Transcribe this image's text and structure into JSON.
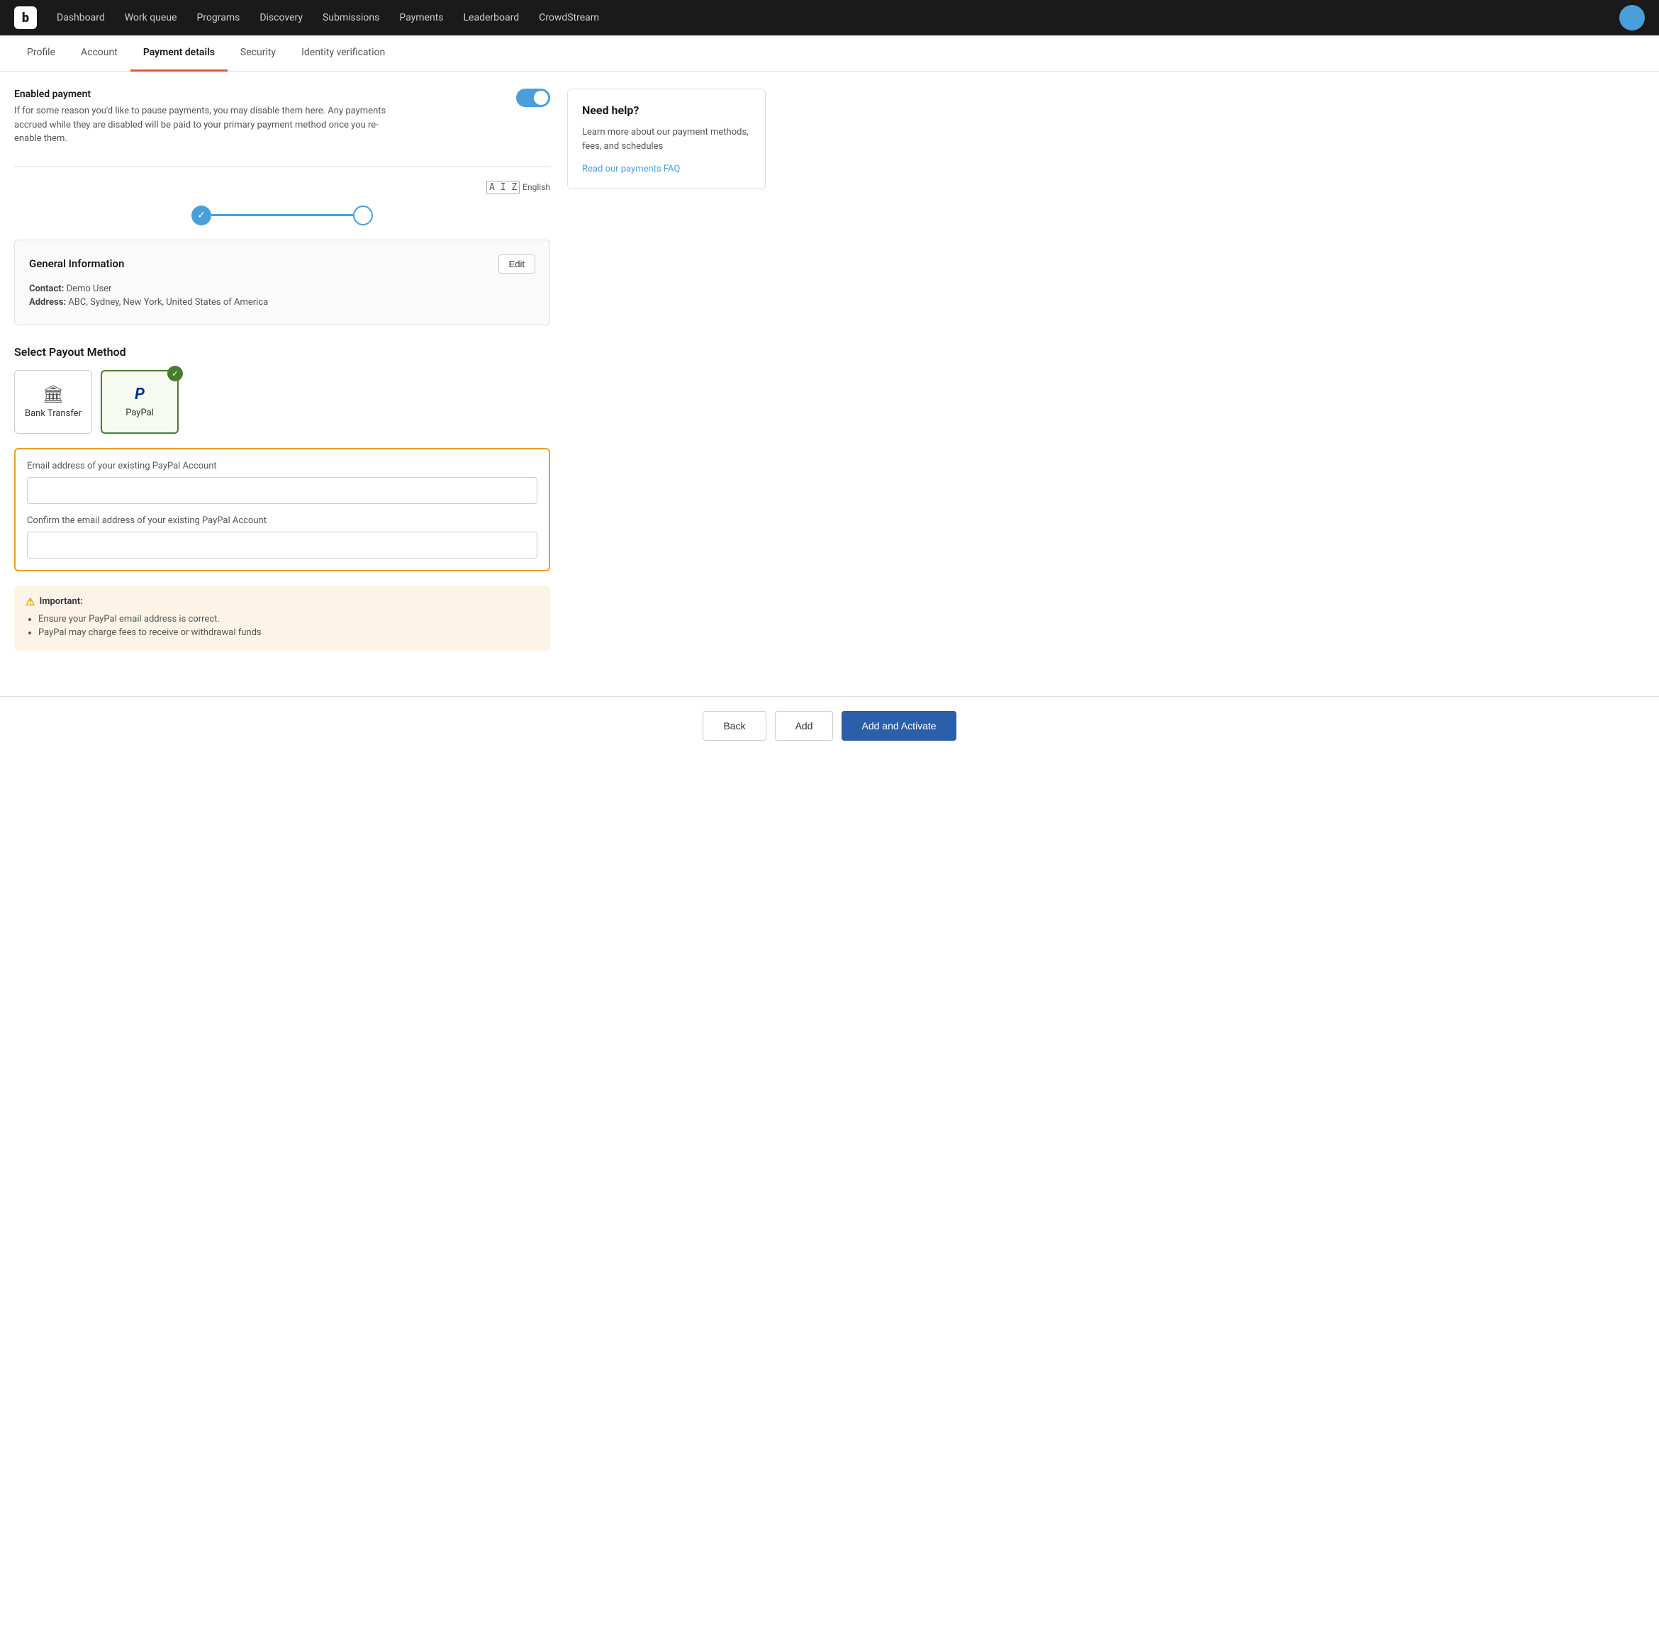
{
  "app": {
    "logo": "b"
  },
  "topnav": {
    "items": [
      {
        "label": "Dashboard",
        "id": "dashboard"
      },
      {
        "label": "Work queue",
        "id": "work-queue"
      },
      {
        "label": "Programs",
        "id": "programs"
      },
      {
        "label": "Discovery",
        "id": "discovery"
      },
      {
        "label": "Submissions",
        "id": "submissions"
      },
      {
        "label": "Payments",
        "id": "payments"
      },
      {
        "label": "Leaderboard",
        "id": "leaderboard"
      },
      {
        "label": "CrowdStream",
        "id": "crowdstream"
      }
    ]
  },
  "tabs": {
    "items": [
      {
        "label": "Profile",
        "id": "profile",
        "active": false
      },
      {
        "label": "Account",
        "id": "account",
        "active": false
      },
      {
        "label": "Payment details",
        "id": "payment-details",
        "active": true
      },
      {
        "label": "Security",
        "id": "security",
        "active": false
      },
      {
        "label": "Identity verification",
        "id": "identity-verification",
        "active": false
      }
    ]
  },
  "payment": {
    "enabled_title": "Enabled payment",
    "enabled_description": "If for some reason you'd like to pause payments, you may disable them here. Any payments accrued while they are disabled will be paid to your primary payment method once you re-enable them.",
    "toggle_on": true
  },
  "stepper": {
    "lang_label": "English",
    "step1_done": true,
    "step2_active": false
  },
  "general_info": {
    "title": "General Information",
    "edit_label": "Edit",
    "contact_label": "Contact:",
    "contact_value": "Demo User",
    "address_label": "Address:",
    "address_value": "ABC, Sydney, New York, United States of America"
  },
  "payout": {
    "section_title": "Select Payout Method",
    "methods": [
      {
        "id": "bank-transfer",
        "label": "Bank Transfer",
        "icon": "bank",
        "selected": false
      },
      {
        "id": "paypal",
        "label": "PayPal",
        "icon": "paypal",
        "selected": true
      }
    ]
  },
  "paypal_form": {
    "email_label": "Email address of your existing PayPal Account",
    "email_placeholder": "",
    "confirm_label": "Confirm the email address of your existing PayPal Account",
    "confirm_placeholder": ""
  },
  "notice": {
    "title": "Important:",
    "items": [
      "Ensure your PayPal email address is correct.",
      "PayPal may charge fees to receive or withdrawal funds"
    ]
  },
  "help": {
    "title": "Need help?",
    "description": "Learn more about our payment methods, fees, and schedules",
    "link_label": "Read our payments FAQ"
  },
  "footer": {
    "back_label": "Back",
    "add_label": "Add",
    "add_activate_label": "Add and Activate"
  }
}
